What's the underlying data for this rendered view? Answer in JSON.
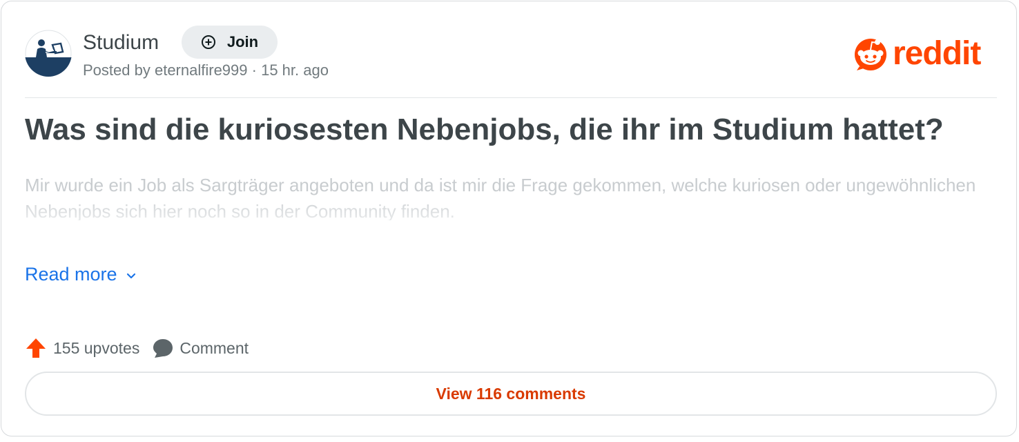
{
  "post": {
    "subreddit": "Studium",
    "join_label": "Join",
    "meta_prefix": "Posted by",
    "author": "eternalfire999",
    "separator": "·",
    "time_ago": "15 hr. ago",
    "title": "Was sind die kuriosesten Nebenjobs, die ihr im Studium hattet?",
    "body": "Mir wurde ein Job als Sargträger angeboten und da ist mir die Frage gekommen, welche kuriosen oder ungewöhnlichen Nebenjobs sich hier noch so in der Community finden.",
    "read_more_label": "Read more",
    "upvotes_label": "155 upvotes",
    "comment_label": "Comment",
    "view_comments_label": "View 116 comments"
  },
  "brand": {
    "logo_text": "reddit",
    "accent_color": "#ff4500",
    "link_color": "#1a73e8"
  },
  "icons": {
    "avatar": "subreddit-avatar-icon",
    "join": "plus-circle-icon",
    "logo": "reddit-snoo-icon",
    "read_more": "chevron-down-icon",
    "upvote": "upvote-arrow-icon",
    "comment": "comment-bubble-icon"
  }
}
